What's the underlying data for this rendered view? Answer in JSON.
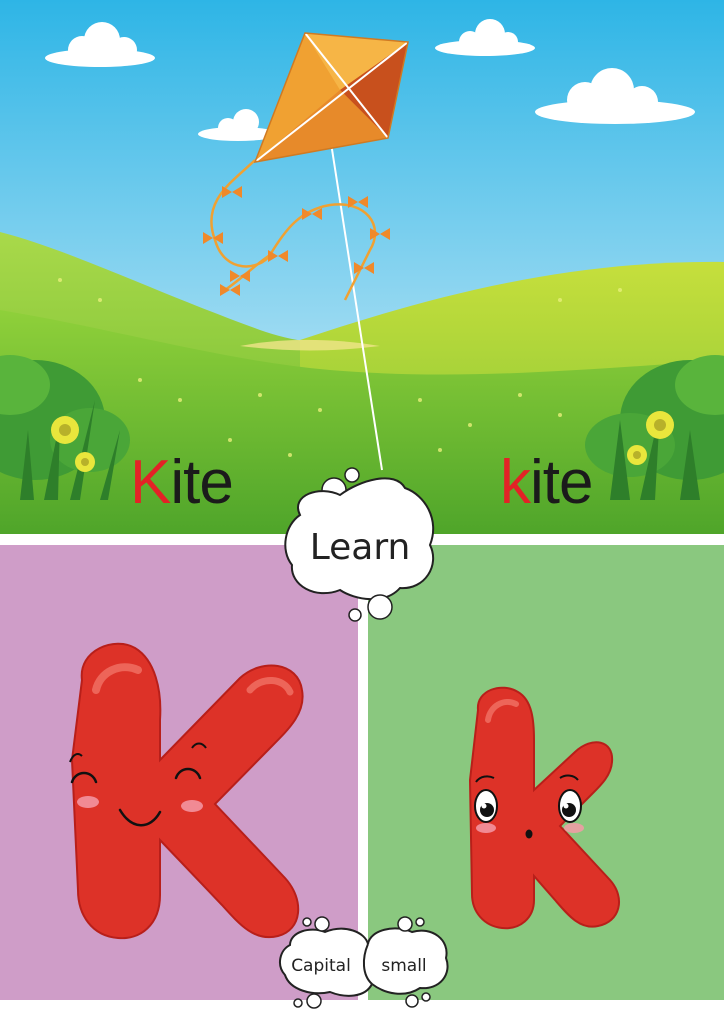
{
  "words": {
    "capital_first": "K",
    "capital_rest": "ite",
    "small_first": "k",
    "small_rest": "ite"
  },
  "bubbles": {
    "learn": "Learn",
    "capital": "Capital",
    "small": "small"
  },
  "colors": {
    "sky_top": "#2eb5e6",
    "sky_bottom": "#c8ecf7",
    "hill_green": "#7cc833",
    "kite_orange": "#f0a132",
    "letter_red": "#e32226",
    "panel_pink": "#cf9dc8",
    "panel_green": "#8ac87f",
    "letter_character_red": "#dd3228"
  },
  "icons": {
    "kite": "kite-icon",
    "capital_k": "capital-k-character-icon",
    "small_k": "small-k-character-icon"
  }
}
